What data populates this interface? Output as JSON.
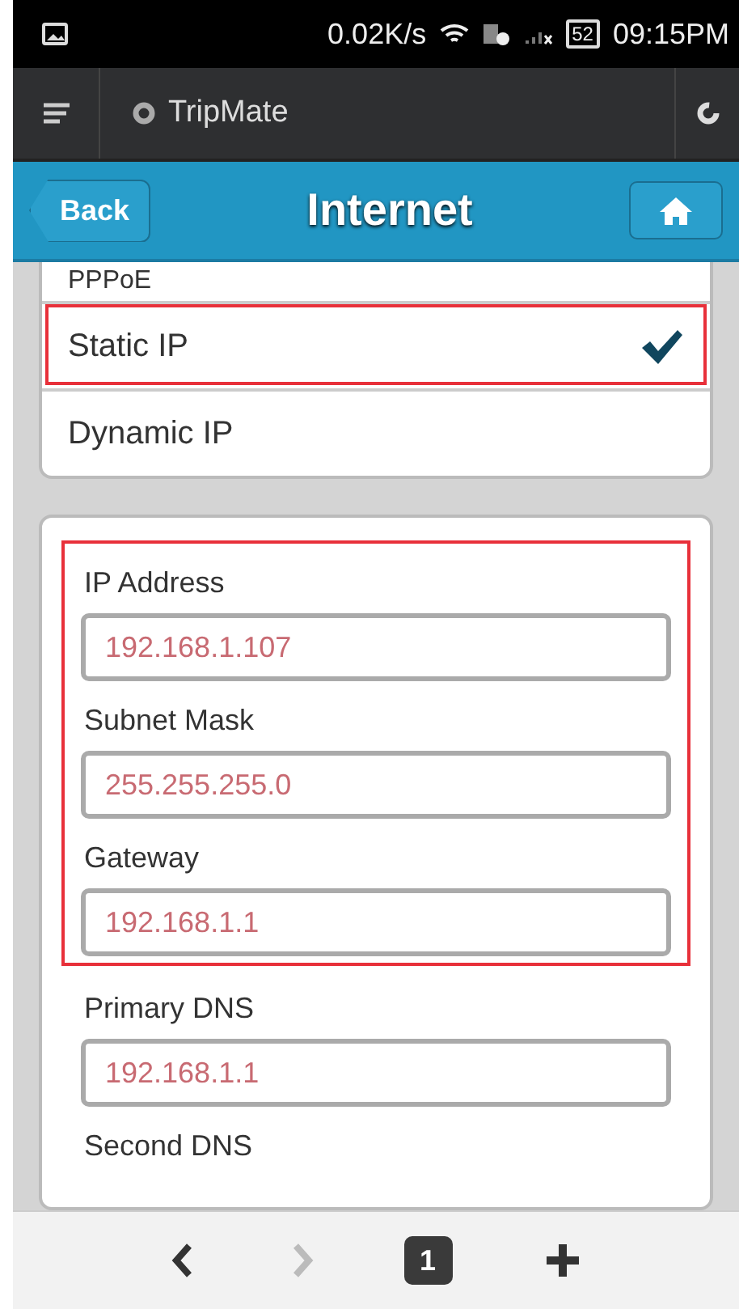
{
  "status_bar": {
    "speed": "0.02K/s",
    "battery": "52",
    "time": "09:15PM"
  },
  "app_bar": {
    "title": "TripMate"
  },
  "header": {
    "back": "Back",
    "title": "Internet"
  },
  "connection_types": [
    {
      "label": "PPPoE",
      "selected": false,
      "highlighted": false
    },
    {
      "label": "Static IP",
      "selected": true,
      "highlighted": true
    },
    {
      "label": "Dynamic IP",
      "selected": false,
      "highlighted": false
    }
  ],
  "fields": [
    {
      "label": "IP Address",
      "value": "192.168.1.107",
      "highlighted": true
    },
    {
      "label": "Subnet Mask",
      "value": "255.255.255.0",
      "highlighted": true
    },
    {
      "label": "Gateway",
      "value": "192.168.1.1",
      "highlighted": true
    },
    {
      "label": "Primary DNS",
      "value": "192.168.1.1",
      "highlighted": false
    },
    {
      "label": "Second DNS",
      "highlighted": false
    }
  ],
  "bottom_nav": {
    "back_disabled": false,
    "forward_disabled": true,
    "tab_count": "1"
  }
}
